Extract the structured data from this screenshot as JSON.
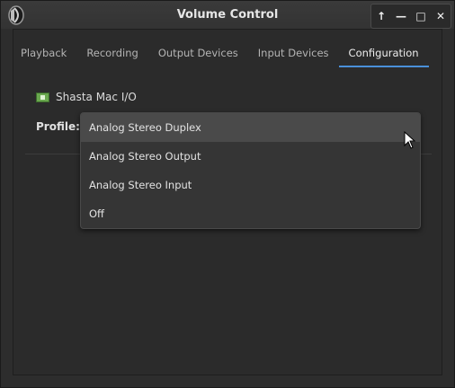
{
  "window": {
    "title": "Volume Control",
    "buttons": [
      "↑",
      "—",
      "□",
      "✕"
    ]
  },
  "tabs": [
    {
      "label": "Playback",
      "active": false
    },
    {
      "label": "Recording",
      "active": false
    },
    {
      "label": "Output Devices",
      "active": false
    },
    {
      "label": "Input Devices",
      "active": false
    },
    {
      "label": "Configuration",
      "active": true
    }
  ],
  "device": {
    "name": "Shasta Mac I/O",
    "icon": "sound-card-icon"
  },
  "profile": {
    "label": "Profile:",
    "selected": "Analog Stereo Duplex",
    "options": [
      "Analog Stereo Duplex",
      "Analog Stereo Output",
      "Analog Stereo Input",
      "Off"
    ]
  },
  "colors": {
    "accent": "#4a90d9",
    "background": "#2b2b2b"
  }
}
